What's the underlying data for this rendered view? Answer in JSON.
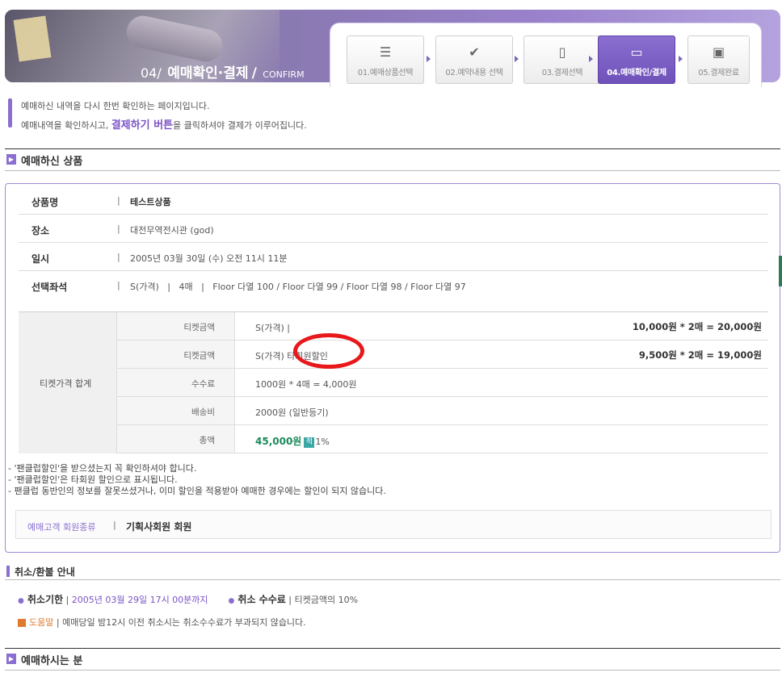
{
  "header": {
    "title_num": "04",
    "title_name": "예매확인·결제",
    "title_en": "CONFIRM"
  },
  "steps": [
    {
      "label": "01.예매상품선택",
      "icon": "list-icon"
    },
    {
      "label": "02.예약내용 선택",
      "icon": "check-document-icon"
    },
    {
      "label": "03.결제선택",
      "icon": "clipboard-icon"
    },
    {
      "label": "04.예매확인/결제",
      "icon": "ticket-icon"
    },
    {
      "label": "05.결제완료",
      "icon": "box-icon"
    }
  ],
  "intro": {
    "line1": "예매하신 내역을 다시 한번 확인하는 페이지입니다.",
    "line2_pre": "예매내역을 확인하시고, ",
    "line2_hl": "결제하기 버튼",
    "line2_post": "을 클릭하셔야 결제가 이루어집니다."
  },
  "sections": {
    "product": "예매하신 상품",
    "cancel": "취소/환불 안내",
    "buyer": "예매하시는 분"
  },
  "product_info": [
    {
      "key": "상품명",
      "sep": "|",
      "value": "테스트상품"
    },
    {
      "key": "장소",
      "sep": "|",
      "value": "대전무역전시관 (god)"
    },
    {
      "key": "일시",
      "sep": "|",
      "value": "2005년 03월 30일 (수) 오전 11시 11분"
    },
    {
      "key": "선택좌석",
      "sep": "|",
      "value": "S(가격)   |   4매   |   Floor 다열 100 / Floor 다열 99 / Floor 다열 98 / Floor 다열 97"
    }
  ],
  "price": {
    "header": "티켓가격 합계",
    "rows": [
      {
        "key": "티켓금액",
        "value": "S(가격) |",
        "right": "10,000원 * 2매 = 20,000원"
      },
      {
        "key": "티켓금액",
        "value": "S(가격) 타회원할인",
        "right": "9,500원 * 2매 = 19,000원"
      },
      {
        "key": "수수료",
        "value": "1000원 * 4매 = 4,000원",
        "right": ""
      },
      {
        "key": "배송비",
        "value": "2000원 (일반등기)",
        "right": ""
      },
      {
        "key": "총액",
        "value": "45,000원",
        "badge": "적",
        "after": "1%",
        "right": ""
      }
    ]
  },
  "notes": [
    "- '팬클럽할인'을 받으셨는지 꼭 확인하셔야 합니다.",
    "- '팬클럽할인'은 타회원 할인으로 표시됩니다.",
    "- 팬클럽 동반인의 정보를 잘못쓰셨거나, 이미 할인을 적용받아 예매한 경우에는 할인이 되지 않습니다."
  ],
  "member": {
    "key": "예매고객 회원종류",
    "sep": "|",
    "value": "기획사회원 회원"
  },
  "cancel": {
    "deadline_label": "취소기한",
    "deadline_value": "2005년 03월 29일 17시 00분까지",
    "fee_label": "취소 수수료",
    "fee_value": "티켓금액의 10%",
    "help_label": "도움말",
    "help_text": "예매당일 밤12시 이전 취소시는 취소수수료가 부과되지 않습니다."
  }
}
